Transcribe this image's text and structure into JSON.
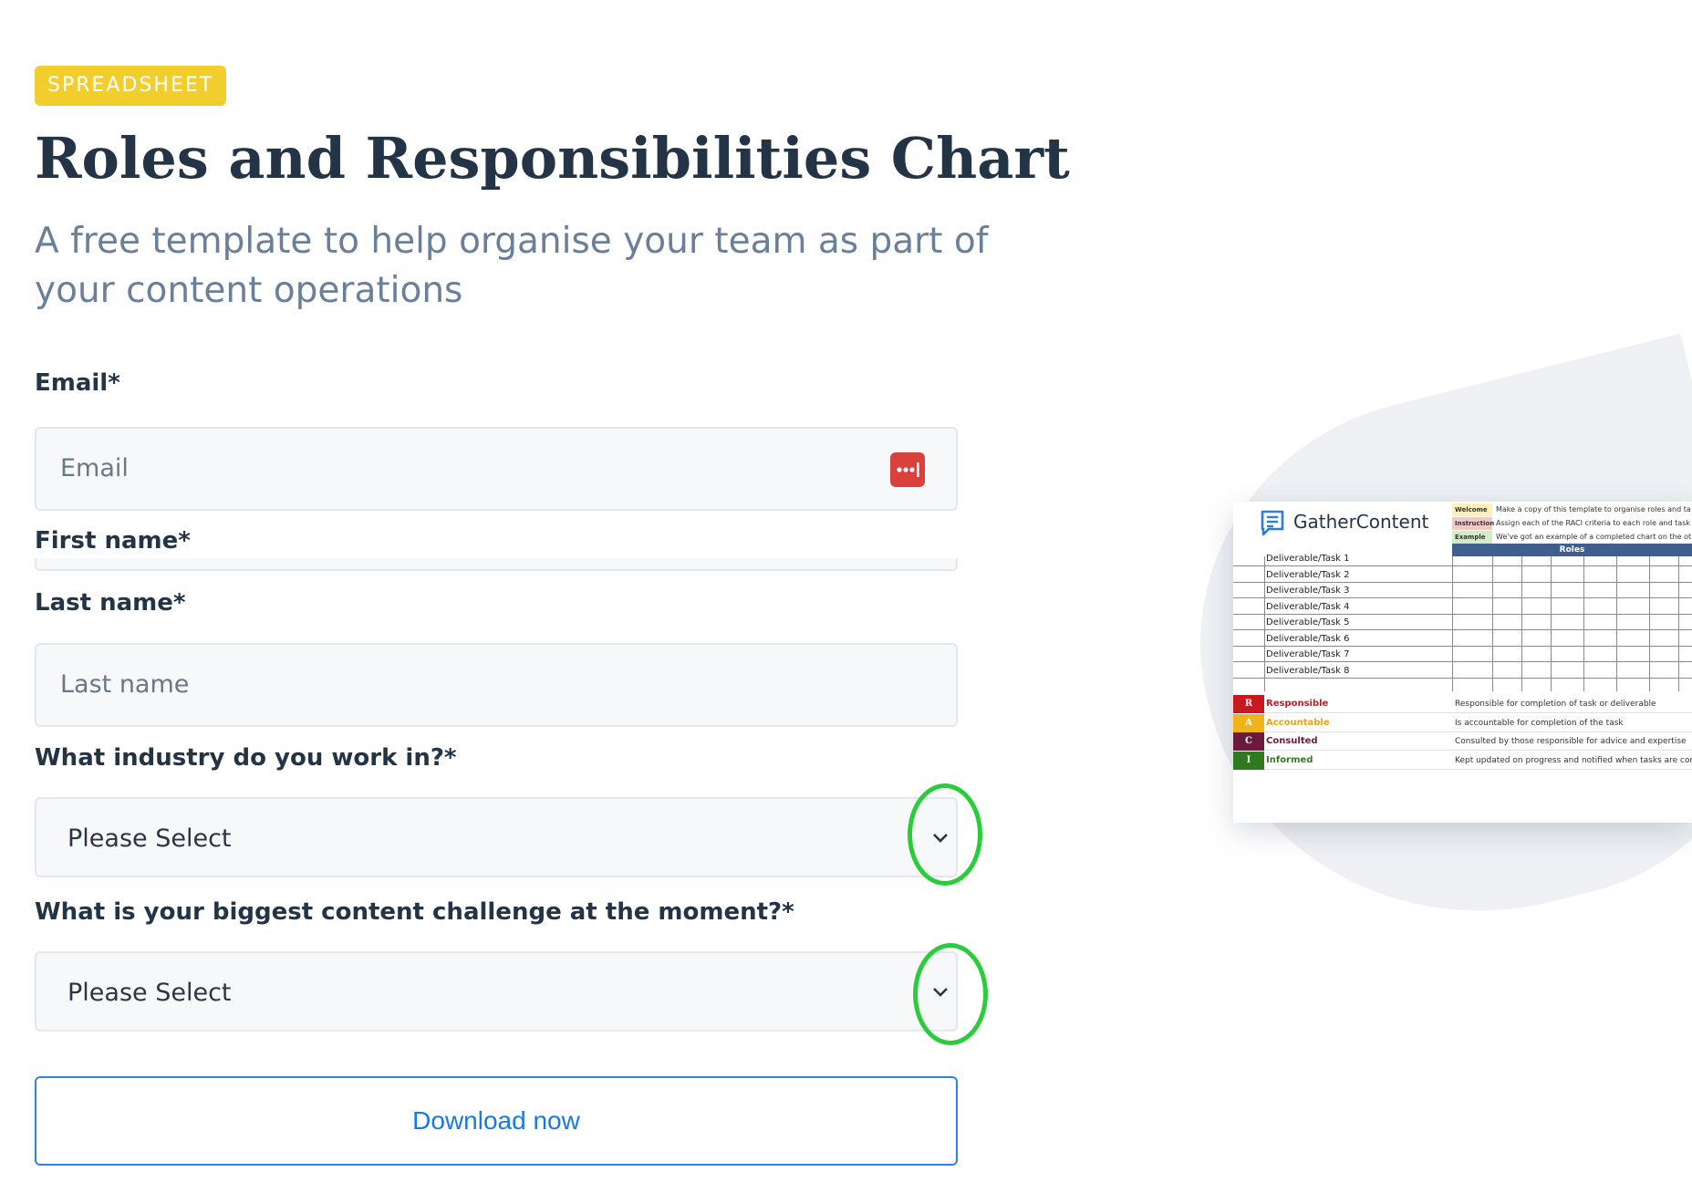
{
  "badge": "SPREADSHEET",
  "title": "Roles and Responsibilities Chart",
  "subtitle": "A free template to help organise your team as part of your content operations",
  "form": {
    "email": {
      "label": "Email*",
      "placeholder": "Email"
    },
    "first_name": {
      "label": "First name*"
    },
    "last_name": {
      "label": "Last name*",
      "placeholder": "Last name"
    },
    "industry": {
      "label": "What industry do you work in?*",
      "value": "Please Select"
    },
    "challenge": {
      "label": "What is your biggest content challenge at the moment?*",
      "value": "Please Select"
    },
    "submit_label": "Download now"
  },
  "colors": {
    "badge": "#f2cd2e",
    "button_text": "#1778ea",
    "annotation_ring": "#2bcc3a",
    "password_manager_icon": "#d9413a"
  },
  "icons": {
    "password_manager": "password-manager-icon",
    "dropdown": "chevron-down-icon",
    "logo": "gathercontent-logo-icon"
  },
  "preview": {
    "brand": "GatherContent",
    "info_rows": [
      {
        "tag": "Welcome",
        "text": "Make a copy of this template to organise roles and ta",
        "color": "#fdf1b8"
      },
      {
        "tag": "Instruction",
        "text": "Assign each of the RACI criteria to each role and task",
        "color": "#f3c9c6"
      },
      {
        "tag": "Example",
        "text": "We've got an example of a completed chart on the ot",
        "color": "#d3ecc6"
      }
    ],
    "roles_header": "Roles",
    "tasks": [
      "Deliverable/Task 1",
      "Deliverable/Task 2",
      "Deliverable/Task 3",
      "Deliverable/Task 4",
      "Deliverable/Task 5",
      "Deliverable/Task 6",
      "Deliverable/Task 7",
      "Deliverable/Task 8"
    ],
    "legend": [
      {
        "key": "R",
        "name": "Responsible",
        "desc": "Responsible for completion of task or deliverable",
        "key_color": "#c8191f",
        "name_color": "#c8191f"
      },
      {
        "key": "A",
        "name": "Accountable",
        "desc": "Is accountable for completion of the task",
        "key_color": "#f2b319",
        "name_color": "#e8a417"
      },
      {
        "key": "C",
        "name": "Consulted",
        "desc": "Consulted by those responsible for advice and expertise",
        "key_color": "#6b1a3c",
        "name_color": "#6b1a3c"
      },
      {
        "key": "I",
        "name": "Informed",
        "desc": "Kept updated on progress and notified when tasks are complete",
        "key_color": "#2f7a1f",
        "name_color": "#2f7a1f"
      }
    ]
  }
}
